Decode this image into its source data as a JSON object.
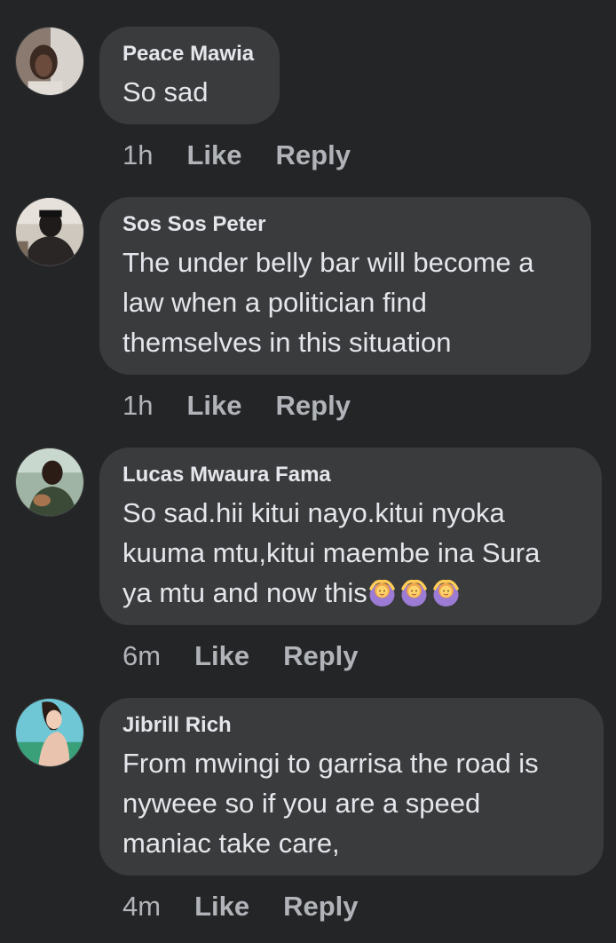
{
  "comments": [
    {
      "author": "Peace Mawia",
      "text": "So sad",
      "time": "1h",
      "like_label": "Like",
      "reply_label": "Reply"
    },
    {
      "author": "Sos Sos Peter",
      "lines": [
        "The under belly bar will become a",
        "law when a politician find",
        "themselves in this situation"
      ],
      "time": "1h",
      "like_label": "Like",
      "reply_label": "Reply"
    },
    {
      "author": "Lucas Mwaura Fama",
      "lines": [
        "So sad.hii kitui nayo.kitui nyoka",
        "kuuma mtu,kitui maembe ina Sura"
      ],
      "last_line_text": "ya mtu and now this",
      "emojis": [
        "person-gesturing-ok-emoji",
        "person-gesturing-ok-emoji",
        "person-gesturing-ok-emoji"
      ],
      "time": "6m",
      "like_label": "Like",
      "reply_label": "Reply"
    },
    {
      "author": "Jibrill Rich",
      "lines": [
        "From mwingi to garrisa the road is",
        "nyweee so if you are a speed",
        "maniac take care,"
      ],
      "time": "4m",
      "like_label": "Like",
      "reply_label": "Reply"
    }
  ],
  "colors": {
    "background": "#242526",
    "bubble": "#3a3b3c",
    "primary_text": "#e4e6eb",
    "secondary_text": "#b0b3b8"
  }
}
